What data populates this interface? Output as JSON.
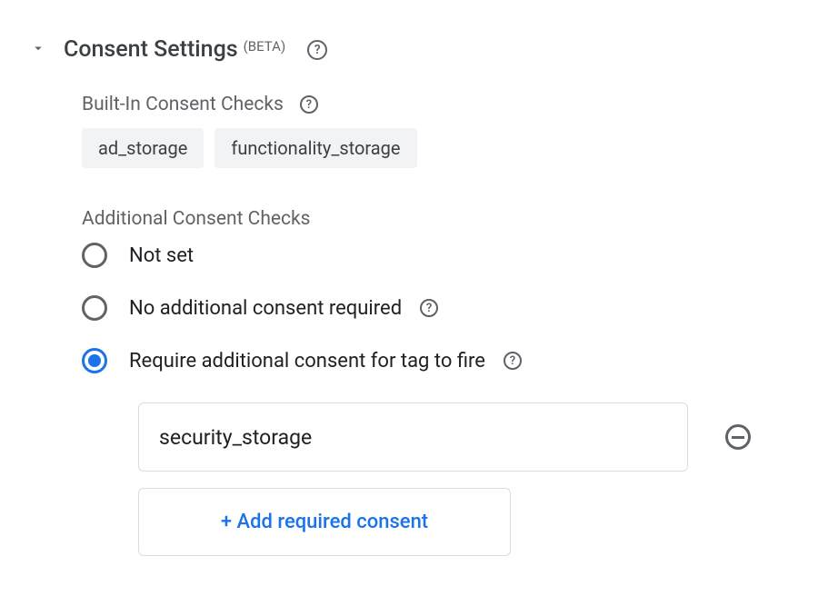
{
  "section": {
    "title": "Consent Settings",
    "beta_label": "(BETA)"
  },
  "built_in": {
    "label": "Built-In Consent Checks",
    "chips": [
      "ad_storage",
      "functionality_storage"
    ]
  },
  "additional": {
    "label": "Additional Consent Checks",
    "options": {
      "not_set": "Not set",
      "no_additional": "No additional consent required",
      "require_additional": "Require additional consent for tag to fire"
    },
    "selected": "require_additional",
    "required_consents": [
      "security_storage"
    ],
    "add_button_label": "+ Add required consent"
  }
}
